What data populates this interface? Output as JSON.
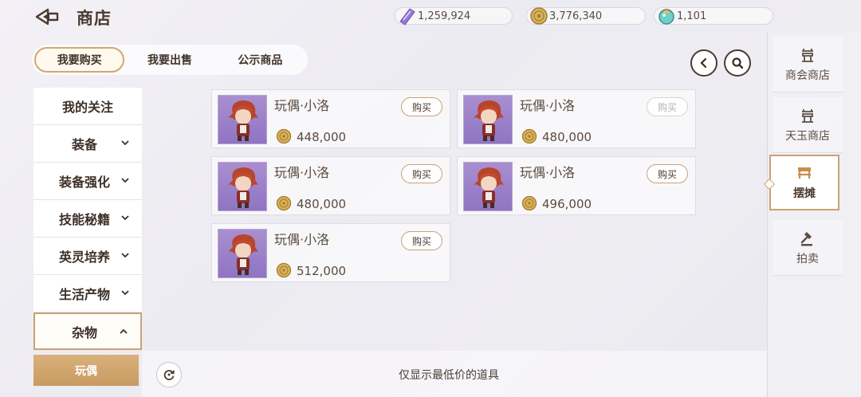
{
  "header": {
    "title": "商店",
    "back_icon": "back-arrow-icon"
  },
  "currencies": [
    {
      "name": "crystal",
      "icon": "purple-crystal-icon",
      "value": "1,259,924"
    },
    {
      "name": "coin",
      "icon": "gold-coin-icon",
      "value": "3,776,340"
    },
    {
      "name": "jade",
      "icon": "jade-orb-icon",
      "value": "1,101"
    }
  ],
  "tabs": [
    {
      "label": "我要购买",
      "active": true
    },
    {
      "label": "我要出售",
      "active": false
    },
    {
      "label": "公示商品",
      "active": false
    }
  ],
  "categories": [
    {
      "label": "我的关注"
    },
    {
      "label": "装备"
    },
    {
      "label": "装备强化"
    },
    {
      "label": "技能秘籍"
    },
    {
      "label": "英灵培养"
    },
    {
      "label": "生活产物"
    },
    {
      "label": "杂物",
      "expanded": true
    }
  ],
  "subcategory": {
    "label": "玩偶"
  },
  "items": [
    {
      "name": "玩偶·小洛",
      "price": "448,000",
      "buy_label": "购买",
      "buy_enabled": true
    },
    {
      "name": "玩偶·小洛",
      "price": "480,000",
      "buy_label": "购买",
      "buy_enabled": false
    },
    {
      "name": "玩偶·小洛",
      "price": "480,000",
      "buy_label": "购买",
      "buy_enabled": true
    },
    {
      "name": "玩偶·小洛",
      "price": "496,000",
      "buy_label": "购买",
      "buy_enabled": true
    },
    {
      "name": "玩偶·小洛",
      "price": "512,000",
      "buy_label": "购买",
      "buy_enabled": true
    }
  ],
  "bottom": {
    "note": "仅显示最低价的道具"
  },
  "side_menu": [
    {
      "label": "商会商店",
      "icon": "guild-shop-icon",
      "active": false
    },
    {
      "label": "天玉商店",
      "icon": "jade-shop-icon",
      "active": false
    },
    {
      "label": "摆摊",
      "icon": "stall-icon",
      "active": true
    },
    {
      "label": "拍卖",
      "icon": "auction-hammer-icon",
      "active": false
    }
  ],
  "colors": {
    "accent": "#caa274",
    "subcat_fill": "#d2a86f",
    "thumb_bg": "#9d83cb"
  }
}
